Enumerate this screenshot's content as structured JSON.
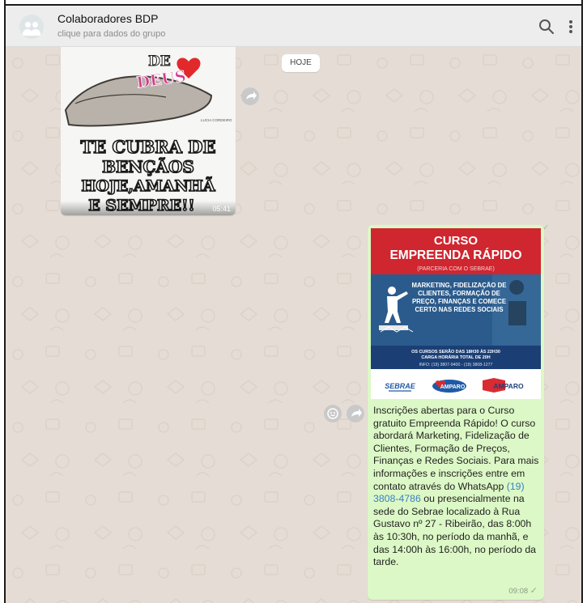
{
  "header": {
    "title": "Colaboradores BDP",
    "subtitle": "clique para dados do grupo",
    "search_icon": "search-icon",
    "menu_icon": "more-vertical-icon"
  },
  "chat": {
    "date_chip": "HOJE",
    "incoming_image": {
      "words_top": "DE",
      "words_mid": "DEUS",
      "line1": "TE CUBRA DE",
      "line2": "BENÇÃOS",
      "line3": "HOJE,AMANHÃ",
      "line4": "E SEMPRE!!",
      "duration": "05:41",
      "signature": "LUCIA CORDEIRO"
    },
    "poster": {
      "kicker": "CURSO",
      "headline": "EMPREENDA RÁPIDO",
      "partner": "(PARCERIA COM O SEBRAE)",
      "topics": "MARKETING, FIDELIZAÇÃO DE CLIENTES, FORMAÇÃO DE PREÇO, FINANÇAS E COMECE CERTO NAS REDES SOCIAIS",
      "schedule1": "OS CURSOS SERÃO DAS 18H30 ÀS 22H30",
      "schedule2": "CARGA HORÁRIA TOTAL DE 20H",
      "info": "INFO: (19) 3807-9400 - (19) 3808-1277",
      "logo1": "SEBRAE",
      "logo2": "AMPARO",
      "logo3": "AMPARO"
    },
    "outgoing": {
      "caption_part1": "Inscrições abertas para o Curso gratuito Empreenda Rápido!  O curso abordará Marketing, Fidelização de Clientes, Formação de Preços, Finanças e Redes Sociais. Para mais informações e inscrições entre em contato através do WhatsApp ",
      "phone_link": "(19) 3808-4786",
      "caption_part2": " ou presencialmente na sede do Sebrae localizado à Rua Gustavo nº 27 - Ribeirão, das 8:00h às 10:30h, no período da manhã, e das 14:00h às 16:00h, no período da tarde.",
      "time": "09:08",
      "status_icon": "check-icon"
    },
    "colors": {
      "header_bg": "#ededed",
      "chat_bg": "#e5ddd5",
      "outgoing_bg": "#dcf8c6",
      "poster_red": "#cf2630",
      "poster_blue": "#1b3f75",
      "link": "#3a7fc4"
    }
  }
}
